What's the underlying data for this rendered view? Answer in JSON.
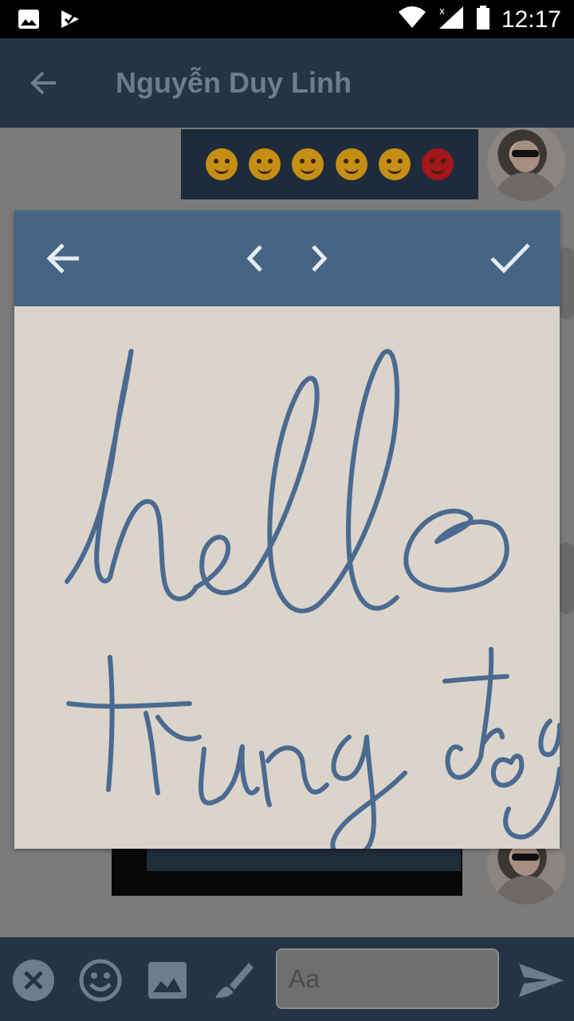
{
  "status_bar": {
    "time": "12:17"
  },
  "header": {
    "title": "Nguyễn Duy Linh"
  },
  "chat": {
    "emoji_message": [
      "smirk-emoji",
      "grin-emoji",
      "wink-tongue-emoji",
      "wink-emoji",
      "kiss-emoji",
      "angry-emoji"
    ]
  },
  "composer": {
    "placeholder": "Aa"
  },
  "drawing": {
    "stroke_color": "#4a6a90",
    "ink_text": "hello trung đôg"
  },
  "colors": {
    "header": "#253445",
    "modal_toolbar": "#466483",
    "canvas": "#dbd4cb",
    "overlay": "#7b7b7b"
  }
}
